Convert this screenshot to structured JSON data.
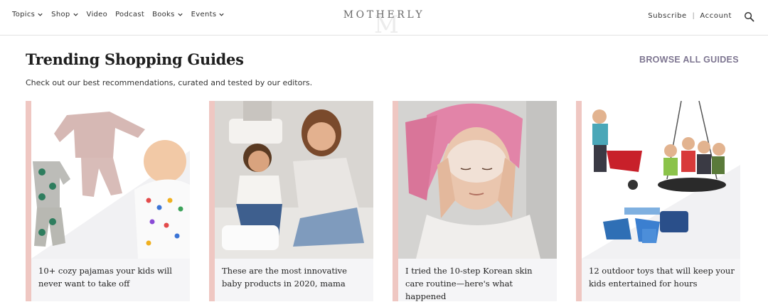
{
  "nav": {
    "items": [
      {
        "label": "Topics",
        "dropdown": true
      },
      {
        "label": "Shop",
        "dropdown": true
      },
      {
        "label": "Video",
        "dropdown": false
      },
      {
        "label": "Podcast",
        "dropdown": false
      },
      {
        "label": "Books",
        "dropdown": true
      },
      {
        "label": "Events",
        "dropdown": true
      }
    ]
  },
  "logo": {
    "text": "MOTHERLY",
    "mark": "M"
  },
  "account": {
    "subscribe": "Subscribe",
    "separator": "|",
    "account": "Account"
  },
  "icons": {
    "search": "search-icon",
    "chevron": "chevron-down-icon"
  },
  "section": {
    "title": "Trending Shopping Guides",
    "browse": "BROWSE ALL GUIDES",
    "subtitle": "Check out our best recommendations, curated and tested by our editors."
  },
  "cards": [
    {
      "caption": "10+ cozy pajamas your kids will never want to take off"
    },
    {
      "caption": "These are the most innovative baby products in 2020, mama"
    },
    {
      "caption": "I tried the 10-step Korean skin care routine—here's what happened"
    },
    {
      "caption": "12 outdoor toys that will keep your kids entertained for hours"
    }
  ],
  "colors": {
    "accent_bar": "#efc7c2",
    "browse_link": "#7e7691",
    "card_bg": "#f5f5f7"
  }
}
